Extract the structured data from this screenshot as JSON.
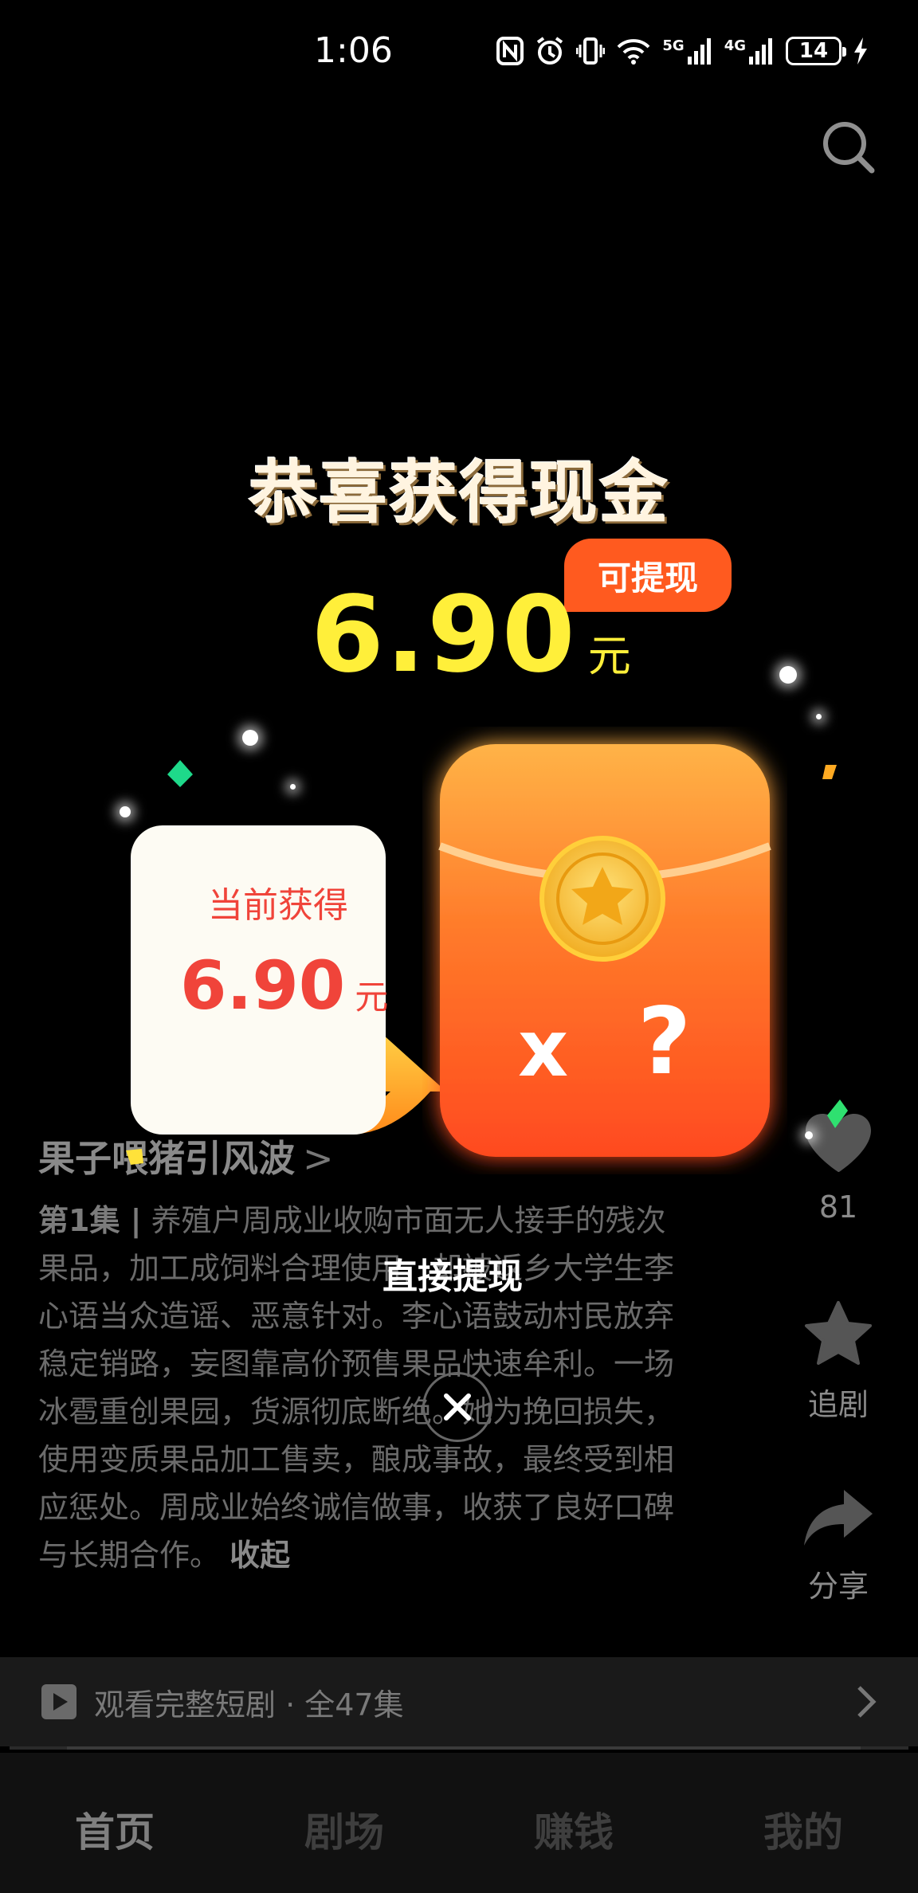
{
  "status_bar": {
    "time": "1:06",
    "network_1": "5G",
    "network_2": "4G",
    "battery": "14"
  },
  "header": {
    "search_icon": "search-icon"
  },
  "popup": {
    "title": "恭喜获得现金",
    "amount": "6.90",
    "amount_unit": "元",
    "badge": "可提现",
    "current_label": "当前获得",
    "current_amount": "6.90",
    "current_unit": "元",
    "multiplier_x": "x",
    "multiplier_q": "?",
    "direct_withdraw": "直接提现",
    "close_icon": "close-icon"
  },
  "video": {
    "title": "果子喂猪引风波",
    "title_arrow": ">",
    "episode": "第1集 |",
    "description": "养殖户周成业收购市面无人接手的残次果品，加工成饲料合理使用，却被返乡大学生李心语当众造谣、恶意针对。李心语鼓动村民放弃稳定销路，妄图靠高价预售果品快速牟利。一场冰雹重创果园，货源彻底断绝。她为挽回损失，使用变质果品加工售卖，酿成事故，最终受到相应惩处。周成业始终诚信做事，收获了良好口碑与长期合作。",
    "collapse": "收起"
  },
  "rail": {
    "like_count": "81",
    "follow_label": "追剧",
    "share_label": "分享"
  },
  "full_drama": {
    "label": "观看完整短剧 · 全47集"
  },
  "tabs": [
    {
      "label": "首页"
    },
    {
      "label": "剧场"
    },
    {
      "label": "赚钱"
    },
    {
      "label": "我的"
    }
  ],
  "colors": {
    "amount": "#ffef3a",
    "badge": "#ff5a1f",
    "red_text": "#f0443a",
    "envelope_top": "#ffb347",
    "envelope_bottom": "#ff4a1f"
  }
}
